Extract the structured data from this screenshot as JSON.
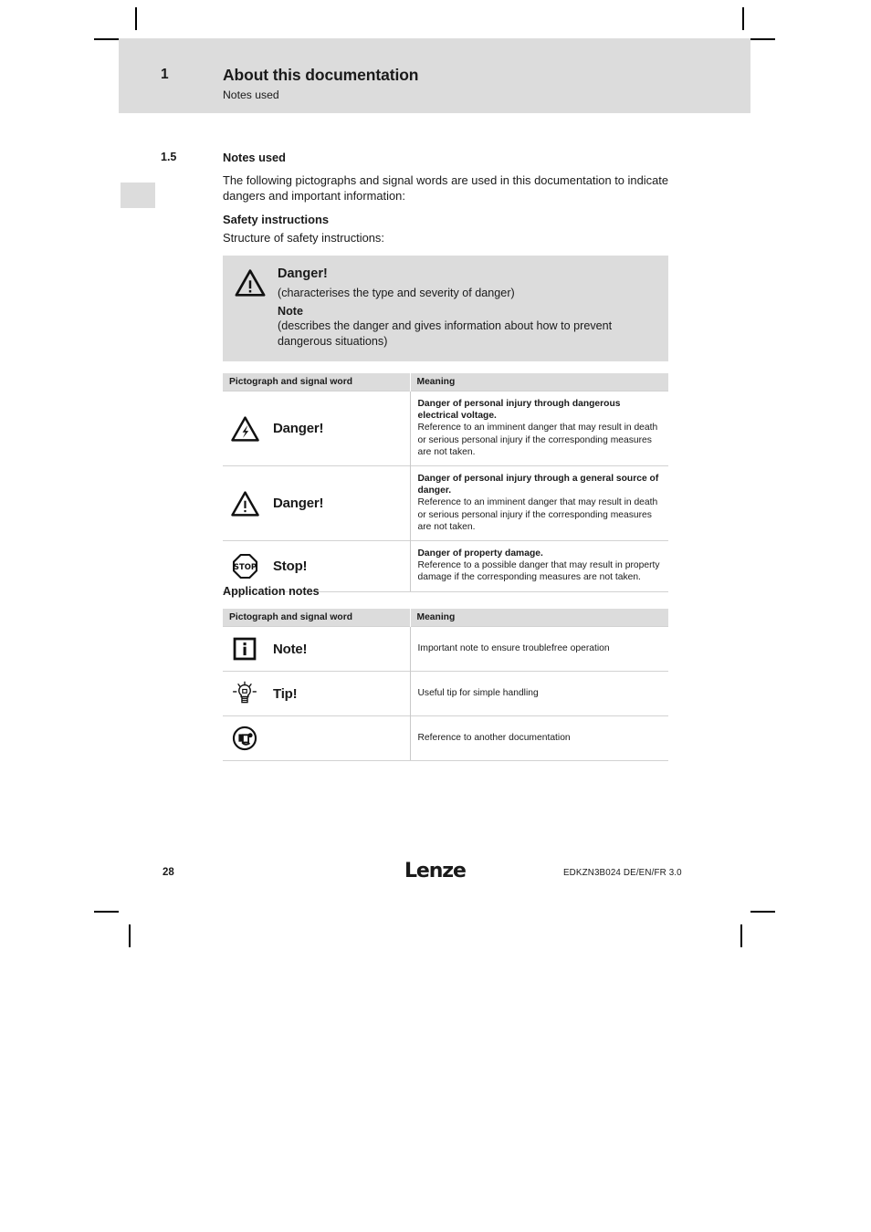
{
  "header": {
    "chapter_number": "1",
    "chapter_title": "About this documentation",
    "subtitle": "Notes used"
  },
  "section": {
    "number": "1.5",
    "title": "Notes used",
    "intro": "The following pictographs and signal words are used in this documentation to indicate dangers and important information:",
    "safety_heading": "Safety instructions",
    "structure_line": "Structure of safety instructions:"
  },
  "callout": {
    "icon": "warning-triangle-icon",
    "title": "Danger!",
    "line1": "(characterises the type and severity of danger)",
    "note_label": "Note",
    "line2": "(describes the danger and gives information about how to prevent dangerous situations)"
  },
  "safety_table": {
    "headers": [
      "Pictograph and signal word",
      "Meaning"
    ],
    "rows": [
      {
        "icon": "electrical-hazard-triangle-icon",
        "signal_word": "Danger!",
        "meaning_bold": "Danger of personal injury through dangerous electrical voltage.",
        "meaning_text": "Reference to an imminent danger that may result in death or serious personal injury if the corresponding measures are not taken."
      },
      {
        "icon": "warning-triangle-icon",
        "signal_word": "Danger!",
        "meaning_bold": "Danger of personal injury through a general source of danger.",
        "meaning_text": "Reference to an imminent danger that may result in death or serious personal injury if the corresponding measures are not taken."
      },
      {
        "icon": "stop-octagon-icon",
        "signal_word": "Stop!",
        "meaning_bold": "Danger of property damage.",
        "meaning_text": "Reference to a possible danger that may result in property damage if the corresponding measures are not taken."
      }
    ]
  },
  "application_notes": {
    "heading": "Application notes",
    "headers": [
      "Pictograph and signal word",
      "Meaning"
    ],
    "rows": [
      {
        "icon": "info-square-icon",
        "signal_word": "Note!",
        "meaning_text": "Important note to ensure troublefree operation"
      },
      {
        "icon": "lightbulb-tip-icon",
        "signal_word": "Tip!",
        "meaning_text": "Useful tip for simple handling"
      },
      {
        "icon": "documentation-reference-icon",
        "signal_word": "",
        "meaning_text": "Reference to another documentation"
      }
    ]
  },
  "footer": {
    "page_number": "28",
    "logo_text": "Lenze",
    "document_id": "EDKZN3B024  DE/EN/FR  3.0"
  },
  "colors": {
    "band_gray": "#dcdcdc",
    "rule_gray": "#d2d2d2",
    "text": "#1a1a1a"
  }
}
